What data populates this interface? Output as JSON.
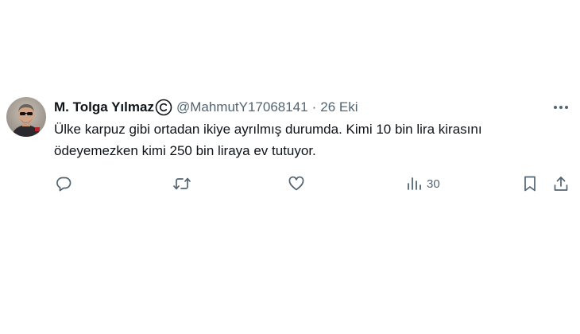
{
  "tweet": {
    "author_name": "M. Tolga Yılmaz",
    "handle": "@MahmutY17068141",
    "separator": "·",
    "date": "26 Eki",
    "text_line1": "Ülke karpuz gibi ortadan ikiye ayrılmış durumda. Kimi 10 bin lira kirasını",
    "text_line2": "ödeyemezken kimi 250 bin liraya ev tutuyor.",
    "views": "30"
  },
  "icons": {
    "avatar": "avatar",
    "badge": "copyright-icon",
    "more": "more-horizontal-icon",
    "reply": "reply-icon",
    "retweet": "retweet-icon",
    "like": "heart-icon",
    "views": "views-icon",
    "bookmark": "bookmark-icon",
    "share": "share-icon"
  },
  "colors": {
    "text_primary": "#0f1419",
    "text_secondary": "#536471",
    "background": "#ffffff"
  }
}
